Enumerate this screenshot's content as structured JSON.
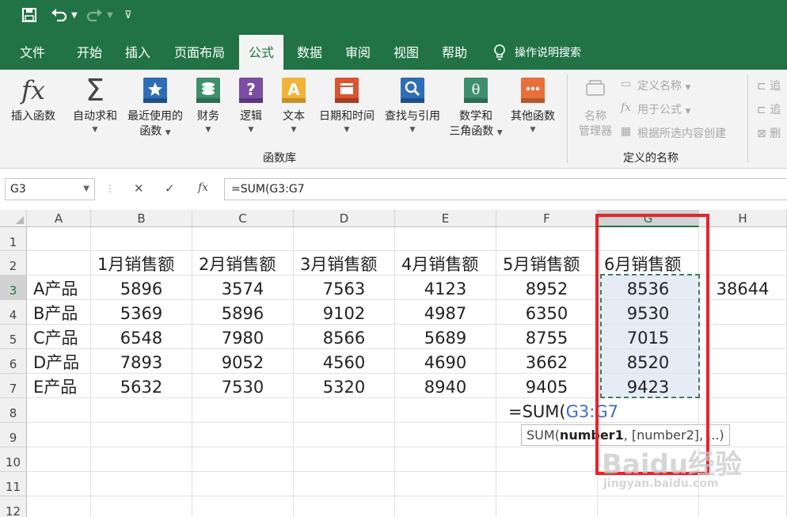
{
  "tabs": [
    {
      "label": "文件",
      "active": false
    },
    {
      "label": "开始",
      "active": false
    },
    {
      "label": "插入",
      "active": false
    },
    {
      "label": "页面布局",
      "active": false
    },
    {
      "label": "公式",
      "active": true
    },
    {
      "label": "数据",
      "active": false
    },
    {
      "label": "审阅",
      "active": false
    },
    {
      "label": "视图",
      "active": false
    },
    {
      "label": "帮助",
      "active": false
    }
  ],
  "tell_me": "操作说明搜索",
  "ribbon": {
    "function_library": {
      "insert_function": "插入函数",
      "autosum": "自动求和",
      "recent_line1": "最近使用的",
      "recent_line2": "函数",
      "financial": "财务",
      "logical": "逻辑",
      "text": "文本",
      "datetime": "日期和时间",
      "lookup": "查找与引用",
      "math_line1": "数学和",
      "math_line2": "三角函数",
      "more": "其他函数",
      "group_label": "函数库"
    },
    "defined_names": {
      "name_manager_line1": "名称",
      "name_manager_line2": "管理器",
      "define_name": "定义名称",
      "use_in_formula": "用于公式",
      "create_from_selection": "根据所选内容创建",
      "group_label": "定义的名称"
    },
    "auditing_partial": [
      "追",
      "追",
      "删"
    ]
  },
  "formula_bar": {
    "name_box": "G3",
    "formula": "=SUM(G3:G7"
  },
  "sheet": {
    "columns": [
      "A",
      "B",
      "C",
      "D",
      "E",
      "F",
      "G",
      "H"
    ],
    "rows": [
      "1",
      "2",
      "3",
      "4",
      "5",
      "6",
      "7",
      "8",
      "9",
      "10",
      "11",
      "12"
    ],
    "headers": [
      "1月销售额",
      "2月销售额",
      "3月销售额",
      "4月销售额",
      "5月销售额",
      "6月销售额"
    ],
    "data": [
      {
        "product": "A产品",
        "values": [
          "5896",
          "3574",
          "7563",
          "4123",
          "8952",
          "8536"
        ]
      },
      {
        "product": "B产品",
        "values": [
          "5369",
          "5896",
          "9102",
          "4987",
          "6350",
          "9530"
        ]
      },
      {
        "product": "C产品",
        "values": [
          "6548",
          "7980",
          "8566",
          "5689",
          "8755",
          "7015"
        ]
      },
      {
        "product": "D产品",
        "values": [
          "7893",
          "9052",
          "4560",
          "4690",
          "3662",
          "8520"
        ]
      },
      {
        "product": "E产品",
        "values": [
          "5632",
          "7530",
          "5320",
          "8940",
          "9405",
          "9423"
        ]
      }
    ],
    "h3": "38644",
    "edit_prefix": "=SUM(",
    "edit_ref": "G3:G7"
  },
  "tooltip": {
    "prefix": "SUM(",
    "bold": "number1",
    "suffix": ", [number2], ...)"
  },
  "colors": {
    "excel_green": "#217346",
    "highlight_red": "#e8232d",
    "selection_fill": "#e6ecf6"
  }
}
